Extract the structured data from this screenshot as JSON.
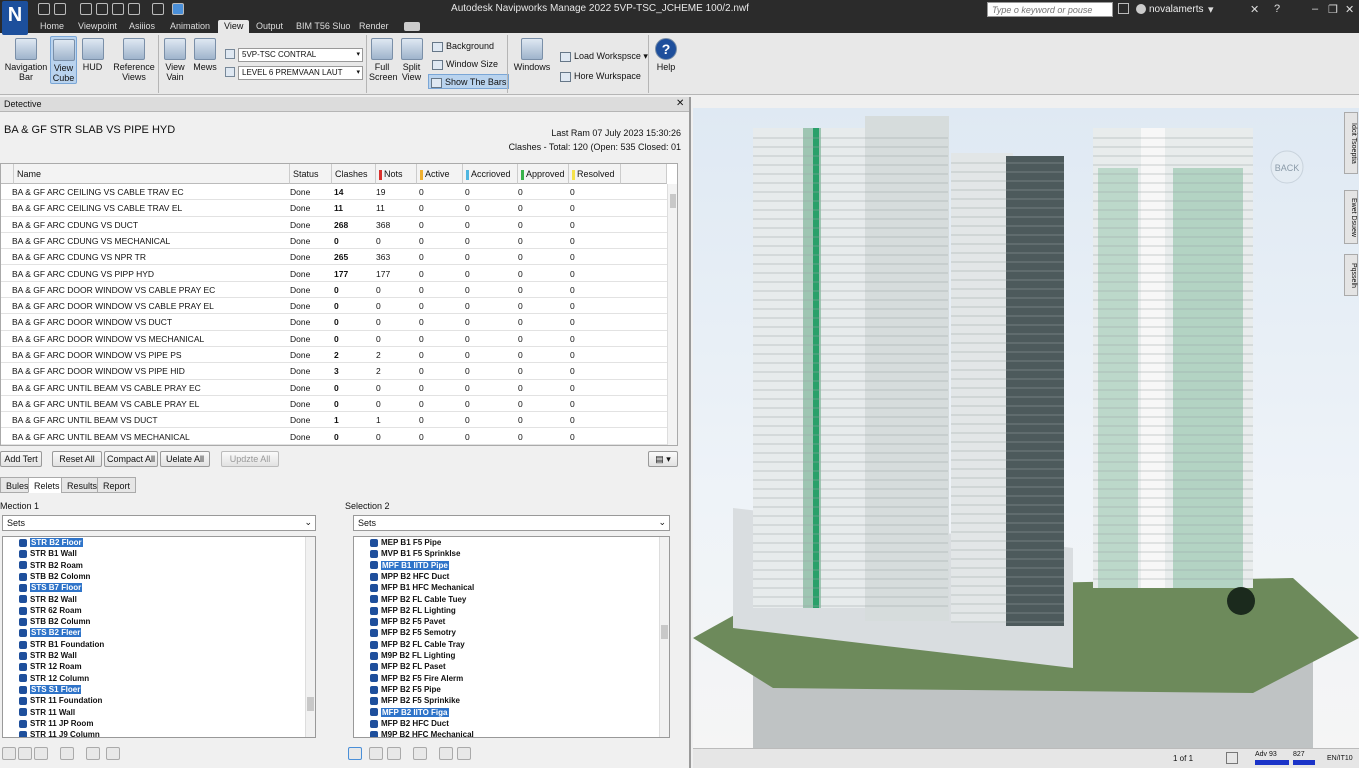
{
  "app": {
    "title": "Autodesk Navipworks Manage 2022   5VP-TSC_JCHEME 100/2.nwf",
    "logo": "N",
    "search_placeholder": "Type o keyword or pouse",
    "user": "novalamerts"
  },
  "ribbon_tabs": [
    "Home",
    "Viewpoint",
    "Asiiios",
    "Animation",
    "View",
    "Output",
    "BIM T56 Sluo",
    "Render"
  ],
  "ribbon": {
    "nav_bar": "Navigation Bar",
    "view_cube": "View Cube",
    "hud": "HUD",
    "reference_views": "Reference Views",
    "view_vain": "View Vain",
    "mews": "Mews",
    "combo1": "5VP-TSC CONTRAL",
    "combo2": "LEVEL 6 PREMVAAN LAUT",
    "full_screen": "Full Screen",
    "split_view": "Split View",
    "background": "Background",
    "window_size": "Window Size",
    "show_bars": "Show The Bars",
    "windows": "Windows",
    "load_workspace": "Load Workspsce",
    "hore_workspace": "Hore Wurkspace",
    "help": "Help"
  },
  "panel": {
    "title": "Detective",
    "test_name": "BA & GF STR SLAB VS PIPE HYD",
    "last_run": "Last Ram  07 July 2023 15:30:26",
    "summary": "Clashes - Total:  120  (Open:  535  Closed:  01"
  },
  "grid": {
    "headers": [
      "Name",
      "Status",
      "Clashes",
      "Nots",
      "Active",
      "Accrioved",
      "Approved",
      "Resolved"
    ],
    "rows": [
      [
        "BA & GF ARC CEILING VS CABLE TRAV EC",
        "Done",
        "14",
        "19",
        "0",
        "0",
        "0",
        "0"
      ],
      [
        "BA & GF ARC CEILING VS CABLE TRAV EL",
        "Done",
        "11",
        "11",
        "0",
        "0",
        "0",
        "0"
      ],
      [
        "BA & GF ARC CDUNG VS DUCT",
        "Done",
        "268",
        "368",
        "0",
        "0",
        "0",
        "0"
      ],
      [
        "BA & GF ARC CDUNG VS MECHANICAL",
        "Done",
        "0",
        "0",
        "0",
        "0",
        "0",
        "0"
      ],
      [
        "BA & GF ARC CDUNG VS NPR TR",
        "Done",
        "265",
        "363",
        "0",
        "0",
        "0",
        "0"
      ],
      [
        "BA & GF ARC CDUNG VS PIPP HYD",
        "Done",
        "177",
        "177",
        "0",
        "0",
        "0",
        "0"
      ],
      [
        "BA & GF ARC DOOR WINDOW VS CABLE PRAY EC",
        "Done",
        "0",
        "0",
        "0",
        "0",
        "0",
        "0"
      ],
      [
        "BA & GF ARC DOOR WINDOW VS CABLE PRAY EL",
        "Done",
        "0",
        "0",
        "0",
        "0",
        "0",
        "0"
      ],
      [
        "BA & GF ARC DOOR WINDOW VS DUCT",
        "Done",
        "0",
        "0",
        "0",
        "0",
        "0",
        "0"
      ],
      [
        "BA & GF ARC DOOR WINDOW VS MECHANICAL",
        "Done",
        "0",
        "0",
        "0",
        "0",
        "0",
        "0"
      ],
      [
        "BA & GF ARC DOOR WINDOW VS PIPE PS",
        "Done",
        "2",
        "2",
        "0",
        "0",
        "0",
        "0"
      ],
      [
        "BA & GF ARC DOOR WINDOW VS PIPE HID",
        "Done",
        "3",
        "2",
        "0",
        "0",
        "0",
        "0"
      ],
      [
        "BA & GF ARC UNTIL BEAM VS CABLE PRAY EC",
        "Done",
        "0",
        "0",
        "0",
        "0",
        "0",
        "0"
      ],
      [
        "BA & GF ARC UNTIL BEAM VS CABLE PRAY EL",
        "Done",
        "0",
        "0",
        "0",
        "0",
        "0",
        "0"
      ],
      [
        "BA & GF ARC UNTIL BEAM VS DUCT",
        "Done",
        "1",
        "1",
        "0",
        "0",
        "0",
        "0"
      ],
      [
        "BA & GF ARC UNTIL BEAM VS MECHANICAL",
        "Done",
        "0",
        "0",
        "0",
        "0",
        "0",
        "0"
      ]
    ]
  },
  "buttons": {
    "add_test": "Add Tert",
    "reset_all": "Reset All",
    "compact_all": "Compact All",
    "update_all": "Uelate All",
    "update_all_dis": "Updzte All"
  },
  "subtabs": [
    "Bules",
    "Relets",
    "Results",
    "Report"
  ],
  "selection1": {
    "label": "Mection 1",
    "combo": "Sets",
    "items": [
      {
        "t": "STR B2 Floor",
        "hl": true
      },
      {
        "t": "STR B1 Wall"
      },
      {
        "t": "STR B2 Roam"
      },
      {
        "t": "STB B2 Colomn"
      },
      {
        "t": "STS B7 Floor",
        "hl": true
      },
      {
        "t": "STR B2 Wall"
      },
      {
        "t": "STR 62 Roam"
      },
      {
        "t": "STB B2 Column"
      },
      {
        "t": "STS B2 Fleer",
        "hl": true
      },
      {
        "t": "STR B1 Foundation"
      },
      {
        "t": "STR B2 Wall"
      },
      {
        "t": "STR 12 Roam"
      },
      {
        "t": "STR 12 Column"
      },
      {
        "t": "STS S1 Floer",
        "hl": true
      },
      {
        "t": "STR 11 Foundation"
      },
      {
        "t": "STR 11 Wall"
      },
      {
        "t": "STR 11 JP Room"
      },
      {
        "t": "STR 11 J9 Column"
      }
    ]
  },
  "selection2": {
    "label": "Selection 2",
    "combo": "Sets",
    "items": [
      {
        "t": "MEP B1 F5 Pipe"
      },
      {
        "t": "MVP B1 F5 Sprinklse"
      },
      {
        "t": "MPF B1 IITD Pipe",
        "hl": true
      },
      {
        "t": "MPP B2 HFC Duct"
      },
      {
        "t": "MFP B1 HFC Mechanical"
      },
      {
        "t": "MFP B2 FL Cable Tuey"
      },
      {
        "t": "MFP B2 FL Lighting"
      },
      {
        "t": "MFP B2 F5 Pavet"
      },
      {
        "t": "MFP B2 F5 Semotry"
      },
      {
        "t": "MFP B2 FL Cable Tray"
      },
      {
        "t": "M9P B2 FL Lighting"
      },
      {
        "t": "MFP B2 FL Paset"
      },
      {
        "t": "MFP B2 F5 Fire Alerm"
      },
      {
        "t": "MFP B2 F5 Pipe"
      },
      {
        "t": "MFP B2 F5 Sprinkike"
      },
      {
        "t": "MFP B2 IITO Figa",
        "hl": true
      },
      {
        "t": "MFP B2 HFC Duct"
      },
      {
        "t": "M9P B2 HFC Mechanical"
      }
    ]
  },
  "viewport": {
    "back_label": "BACK",
    "right_tabs": [
      "Idcit Tsoeptia",
      "Ewet Dsuew",
      "Pqsselh"
    ]
  },
  "status": {
    "page": "1 of 1",
    "label_a": "Adv",
    "val_a": "93",
    "val_b": "827",
    "extra": "EN/IT10"
  },
  "colors": {
    "nots": "#d9302c",
    "active": "#f0b030",
    "accrioved": "#4fb6e0",
    "approved": "#38b24a",
    "resolved": "#f5e24a",
    "accent": "#2f74c9"
  }
}
